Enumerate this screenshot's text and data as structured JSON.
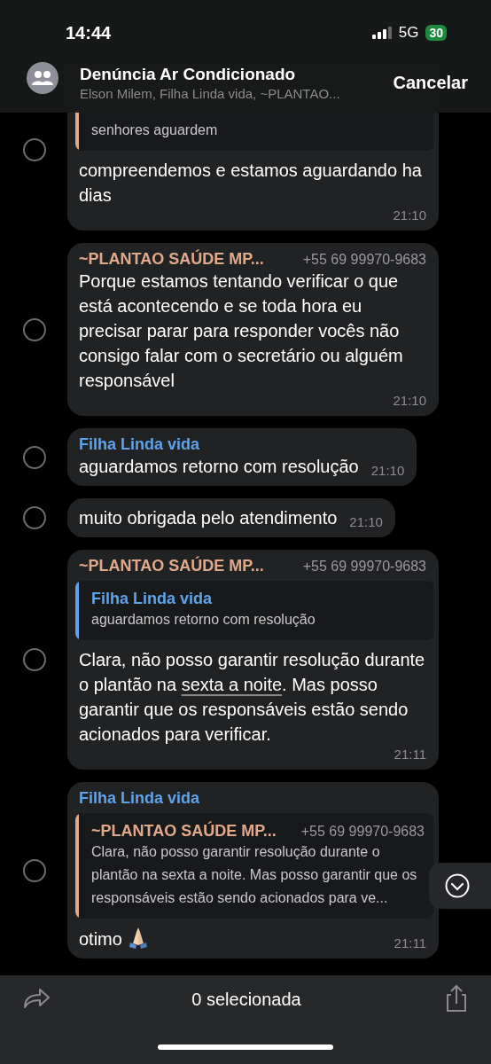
{
  "status_bar": {
    "time": "14:44",
    "network": "5G",
    "battery": "30"
  },
  "header": {
    "title": "Denúncia Ar Condicionado",
    "subtitle": "Elson Milem, Filha Linda vida, ~PLANTAO...",
    "action": "Cancelar"
  },
  "messages": [
    {
      "selected": false,
      "quote": {
        "color": "#e0a98a",
        "text": "senhores aguardem"
      },
      "text": [
        {
          "kind": "plain",
          "text": "compreendemos e estamos aguardando ha  dias"
        }
      ],
      "time": "21:10"
    },
    {
      "selected": false,
      "sender": {
        "name": "~PLANTAO SAÚDE MP...",
        "phone": "+55 69 99970-9683",
        "color": "#e0a98a"
      },
      "text": [
        {
          "kind": "plain",
          "text": "Porque estamos tentando verificar o que está acontecendo e se toda hora eu precisar parar para responder vocês não consigo falar com o secretário ou alguém responsável"
        }
      ],
      "time": "21:10"
    },
    {
      "selected": false,
      "sender": {
        "name": "Filha Linda vida",
        "color": "#5fa3ea"
      },
      "text": [
        {
          "kind": "plain",
          "text": "aguardamos retorno com resolução"
        }
      ],
      "time": "21:10"
    },
    {
      "selected": false,
      "text": [
        {
          "kind": "plain",
          "text": "muito obrigada pelo atendimento"
        }
      ],
      "time": "21:10"
    },
    {
      "selected": false,
      "sender": {
        "name": "~PLANTAO SAÚDE MP...",
        "phone": "+55 69 99970-9683",
        "color": "#e0a98a"
      },
      "quote": {
        "name": "Filha Linda vida",
        "color": "#5fa3ea",
        "text": "aguardamos retorno com resolução"
      },
      "text": [
        {
          "kind": "plain",
          "text": "Clara, não posso garantir resolução durante o plantão na "
        },
        {
          "kind": "link",
          "text": "sexta a noite"
        },
        {
          "kind": "plain",
          "text": ". Mas posso garantir que os responsáveis estão sendo acionados para verificar."
        }
      ],
      "time": "21:11"
    },
    {
      "selected": false,
      "sender": {
        "name": "Filha Linda vida",
        "color": "#5fa3ea"
      },
      "quote": {
        "name": "~PLANTAO SAÚDE MP...",
        "phone": "+55 69 99970-9683",
        "color": "#e0a98a",
        "text": "Clara, não posso garantir resolução durante o plantão na sexta a noite. Mas posso garantir que os responsáveis estão sendo acionados para ve..."
      },
      "text": [
        {
          "kind": "plain",
          "text": "otimo"
        },
        {
          "kind": "praying_hands"
        }
      ],
      "time": "21:11"
    }
  ],
  "bottom_bar": {
    "selection_count": "0 selecionada"
  }
}
